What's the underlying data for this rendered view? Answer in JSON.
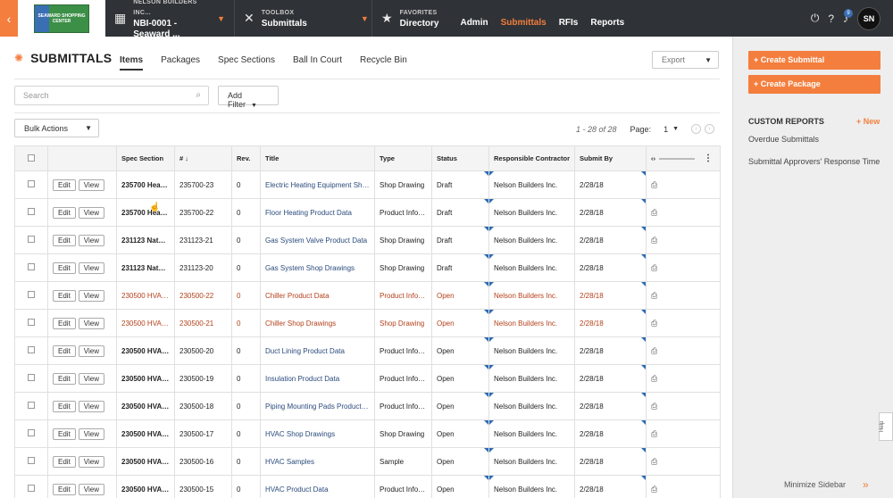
{
  "topbar": {
    "back_icon": "chevron-left-icon",
    "logo_text": "SEAWARD SHOPPING CENTER",
    "project_company": "NELSON BUILDERS INC...",
    "project_name": "NBI-0001 - Seaward ...",
    "toolbox_label": "TOOLBOX",
    "toolbox_value": "Submittals",
    "favorites_label": "FAVORITES",
    "nav": [
      "Directory",
      "Admin",
      "Submittals",
      "RFIs",
      "Reports"
    ],
    "active_nav": "Submittals",
    "notification_count": "9",
    "avatar_initials": "SN"
  },
  "header": {
    "title": "SUBMITTALS",
    "tabs": [
      "Items",
      "Packages",
      "Spec Sections",
      "Ball In Court",
      "Recycle Bin"
    ],
    "active_tab": "Items",
    "export_label": "Export"
  },
  "filters": {
    "search_placeholder": "Search",
    "add_filter_label": "Add Filter",
    "bulk_actions_label": "Bulk Actions"
  },
  "pagination": {
    "range": "1 - 28 of 28",
    "page_label": "Page:",
    "page_value": "1"
  },
  "table": {
    "columns": [
      "Spec Section",
      "#",
      "Rev.",
      "Title",
      "Type",
      "Status",
      "Responsible Contractor",
      "Submit By"
    ],
    "edit_label": "Edit",
    "view_label": "View",
    "rows": [
      {
        "spec": "235700 Heat T...",
        "num": "235700-23",
        "rev": "0",
        "title": "Electric Heating Equipment Shop Dr...",
        "type": "Shop Drawing",
        "status": "Draft",
        "contractor": "Nelson Builders Inc.",
        "submit_by": "2/28/18",
        "highlight": false
      },
      {
        "spec": "235700 Heat T...",
        "num": "235700-22",
        "rev": "0",
        "title": "Floor Heating Product Data",
        "type": "Product Inform...",
        "status": "Draft",
        "contractor": "Nelson Builders Inc.",
        "submit_by": "2/28/18",
        "highlight": false
      },
      {
        "spec": "231123 Natur...",
        "num": "231123-21",
        "rev": "0",
        "title": "Gas System Valve Product Data",
        "type": "Shop Drawing",
        "status": "Draft",
        "contractor": "Nelson Builders Inc.",
        "submit_by": "2/28/18",
        "highlight": false
      },
      {
        "spec": "231123 Natur...",
        "num": "231123-20",
        "rev": "0",
        "title": "Gas System Shop Drawings",
        "type": "Shop Drawing",
        "status": "Draft",
        "contractor": "Nelson Builders Inc.",
        "submit_by": "2/28/18",
        "highlight": false
      },
      {
        "spec": "230500 HVAC ...",
        "num": "230500-22",
        "rev": "0",
        "title": "Chiller Product Data",
        "type": "Product Inform...",
        "status": "Open",
        "contractor": "Nelson Builders Inc.",
        "submit_by": "2/28/18",
        "highlight": true
      },
      {
        "spec": "230500 HVAC ...",
        "num": "230500-21",
        "rev": "0",
        "title": "Chiller Shop Drawings",
        "type": "Shop Drawing",
        "status": "Open",
        "contractor": "Nelson Builders Inc.",
        "submit_by": "2/28/18",
        "highlight": true
      },
      {
        "spec": "230500 HVAC ...",
        "num": "230500-20",
        "rev": "0",
        "title": "Duct Lining Product Data",
        "type": "Product Inform...",
        "status": "Open",
        "contractor": "Nelson Builders Inc.",
        "submit_by": "2/28/18",
        "highlight": false
      },
      {
        "spec": "230500 HVAC ...",
        "num": "230500-19",
        "rev": "0",
        "title": "Insulation Product Data",
        "type": "Product Inform...",
        "status": "Open",
        "contractor": "Nelson Builders Inc.",
        "submit_by": "2/28/18",
        "highlight": false
      },
      {
        "spec": "230500 HVAC ...",
        "num": "230500-18",
        "rev": "0",
        "title": "Piping Mounting Pads Product Data",
        "type": "Product Inform...",
        "status": "Open",
        "contractor": "Nelson Builders Inc.",
        "submit_by": "2/28/18",
        "highlight": false
      },
      {
        "spec": "230500 HVAC ...",
        "num": "230500-17",
        "rev": "0",
        "title": "HVAC Shop Drawings",
        "type": "Shop Drawing",
        "status": "Open",
        "contractor": "Nelson Builders Inc.",
        "submit_by": "2/28/18",
        "highlight": false
      },
      {
        "spec": "230500 HVAC ...",
        "num": "230500-16",
        "rev": "0",
        "title": "HVAC Samples",
        "type": "Sample",
        "status": "Open",
        "contractor": "Nelson Builders Inc.",
        "submit_by": "2/28/18",
        "highlight": false
      },
      {
        "spec": "230500 HVAC ...",
        "num": "230500-15",
        "rev": "0",
        "title": "HVAC Product Data",
        "type": "Product Inform...",
        "status": "Open",
        "contractor": "Nelson Builders Inc.",
        "submit_by": "2/28/18",
        "highlight": false
      }
    ]
  },
  "sidebar": {
    "create_submittal": "+ Create Submittal",
    "create_package": "+ Create Package",
    "custom_reports_heading": "CUSTOM REPORTS",
    "new_link": "+ New",
    "reports": [
      "Overdue Submittals",
      "Submittal Approvers' Response Time"
    ],
    "minimize_label": "Minimize Sidebar",
    "help_label": "Help"
  },
  "colors": {
    "accent": "#f47e3e",
    "topbar": "#2f3236",
    "highlight_text": "#b4401a",
    "link": "#2a4b7c"
  }
}
